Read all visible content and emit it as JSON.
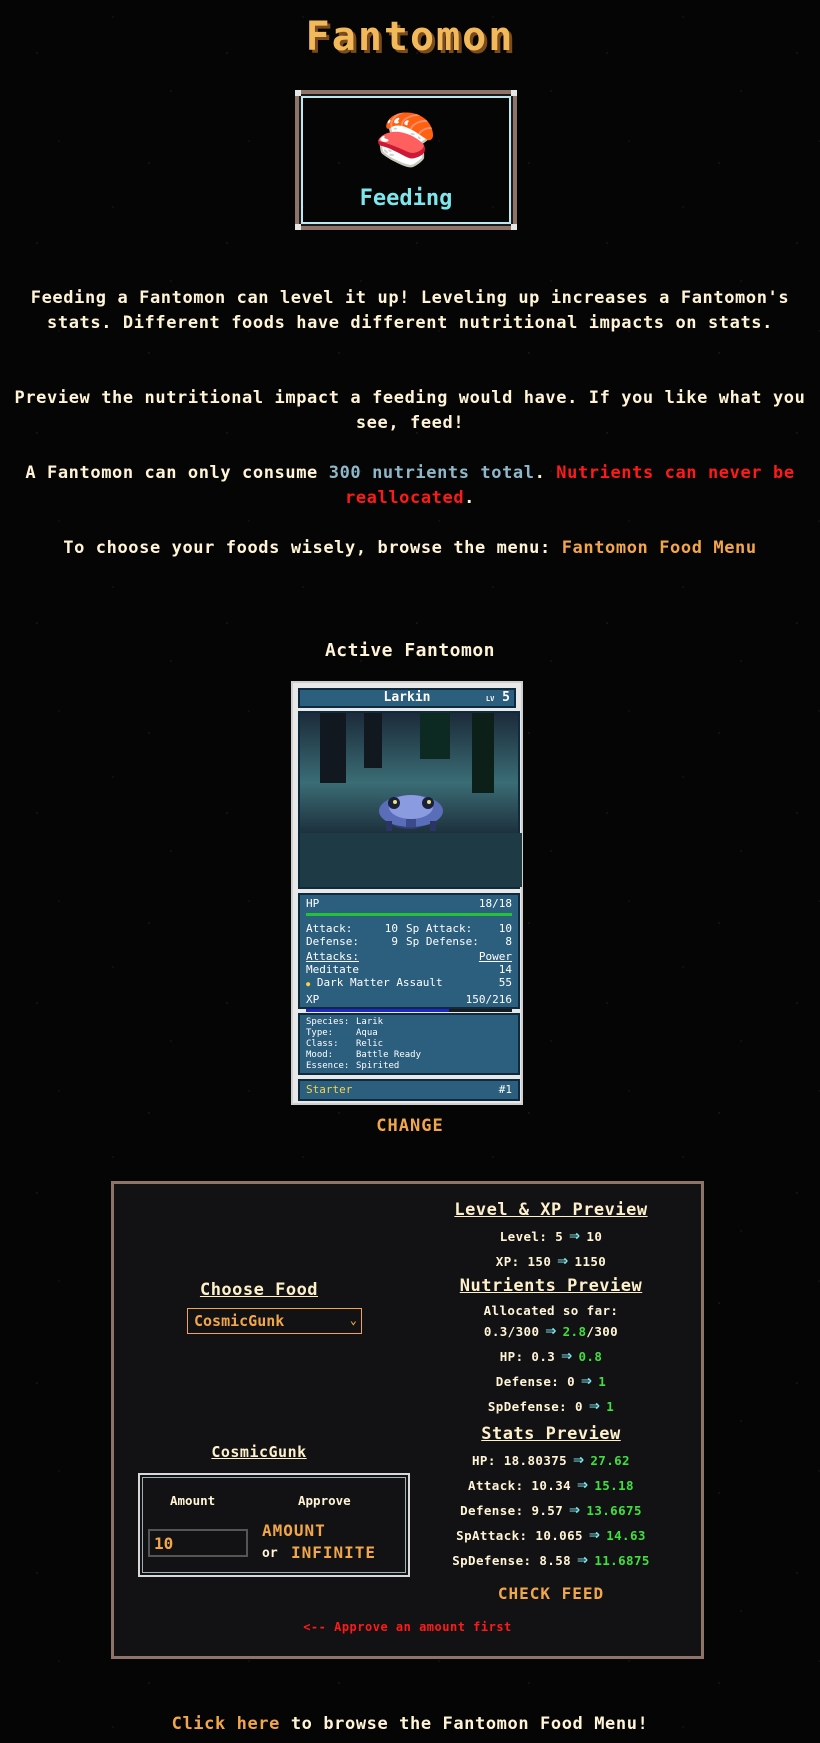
{
  "header": {
    "title": "Fantomon"
  },
  "hero": {
    "icon": "sushi-icon",
    "icon_glyph": "🍣",
    "label": "Feeding"
  },
  "intro": {
    "p1": "Feeding a Fantomon can level it up! Leveling up increases a Fantomon's stats. Different foods have different nutritional impacts on stats.",
    "p2": "Preview the nutritional impact a feeding would have. If you like what you see, feed!",
    "p3_prefix": "A Fantomon can only consume ",
    "p3_highlight": "300 nutrients total",
    "p3_mid": ". ",
    "p3_warning": "Nutrients can never be reallocated",
    "p3_suffix": ".",
    "p4_prefix": "To choose your foods wisely, browse the menu: ",
    "p4_link": "Fantomon Food Menu"
  },
  "active": {
    "title": "Active Fantomon",
    "card": {
      "name": "Larkin",
      "lv_label": "LV",
      "level": "5",
      "hp_label": "HP",
      "hp_value": "18/18",
      "hp_fraction": 1.0,
      "attack_label": "Attack:",
      "attack": "10",
      "sp_attack_label": "Sp Attack:",
      "sp_attack": "10",
      "defense_label": "Defense:",
      "defense": "9",
      "sp_defense_label": "Sp Defense:",
      "sp_defense": "8",
      "attacks_label": "Attacks:",
      "power_label": "Power",
      "move1": "Meditate",
      "move1_power": "14",
      "move2_bullet": "●",
      "move2": "Dark Matter Assault",
      "move2_power": "55",
      "xp_label": "XP",
      "xp_value": "150/216",
      "xp_fraction": 0.694,
      "species_label": "Species:",
      "species": "Larik",
      "type_label": "Type:",
      "type": "Aqua",
      "class_label": "Class:",
      "class": "Relic",
      "mood_label": "Mood:",
      "mood": "Battle Ready",
      "essence_label": "Essence:",
      "essence": "Spirited",
      "starter": "Starter",
      "number": "#1"
    },
    "change_label": "CHANGE"
  },
  "feeding": {
    "choose_title": "Choose Food",
    "selected_food": "CosmicGunk",
    "food_name": "CosmicGunk",
    "amount_header": "Amount",
    "approve_header": "Approve",
    "amount_value": "10",
    "amount_button": "AMOUNT",
    "or_text": "or",
    "infinite_button": "INFINITE",
    "level_preview": {
      "title": "Level & XP Preview",
      "level_label": "Level: 5",
      "level_new": "10",
      "xp_label": "XP: 150",
      "xp_new": "1150"
    },
    "nutrients_preview": {
      "title": "Nutrients Preview",
      "allocated_label": "Allocated so far:",
      "allocated_old": "0.3/300",
      "allocated_new_num": "2.8",
      "allocated_new_den": "/300",
      "hp_label": "HP: 0.3",
      "hp_new": "0.8",
      "def_label": "Defense: 0",
      "def_new": "1",
      "spdef_label": "SpDefense: 0",
      "spdef_new": "1"
    },
    "stats_preview": {
      "title": "Stats Preview",
      "hp_label": "HP: 18.80375",
      "hp_new": "27.62",
      "attack_label": "Attack: 10.34",
      "attack_new": "15.18",
      "defense_label": "Defense: 9.57",
      "defense_new": "13.6675",
      "spattack_label": "SpAttack: 10.065",
      "spattack_new": "14.63",
      "spdefense_label": "SpDefense: 8.58",
      "spdefense_new": "11.6875"
    },
    "arrow_glyph": "⇒",
    "check_feed": "CHECK FEED",
    "approve_message": "<-- Approve an amount first"
  },
  "footer": {
    "link": "Click here",
    "text": " to browse the Fantomon Food Menu!"
  },
  "colors": {
    "accent": "#f2a64a",
    "title": "#f2b95a",
    "cyan": "#7ee7ec",
    "green": "#3ee03e",
    "red": "#ff1a1a",
    "frame": "#8e7468"
  }
}
